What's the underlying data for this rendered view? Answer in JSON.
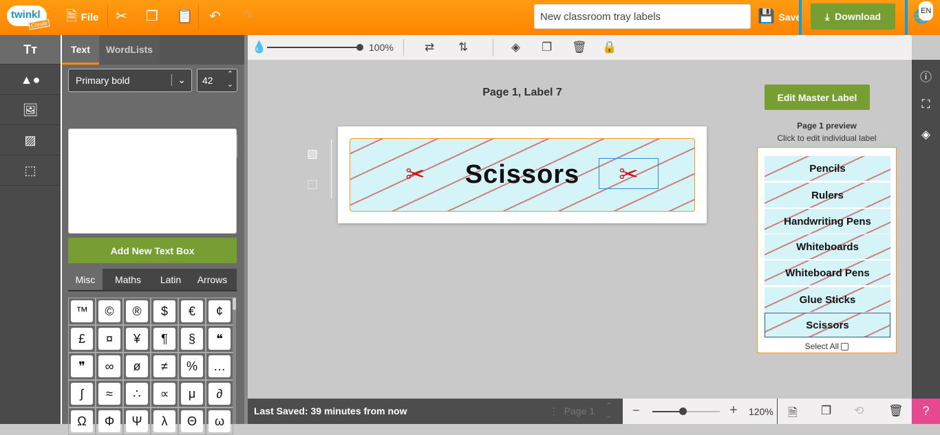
{
  "header": {
    "logo_text": "twinkl",
    "logo_sub": "Create",
    "file_label": "File",
    "document_title": "New classroom tray labels",
    "save_label": "Save",
    "download_label": "Download",
    "language": "EN"
  },
  "colors": {
    "brand_orange": "#ff8c00",
    "accent_green": "#779e32",
    "highlight_blue": "#0aa0e6",
    "help_pink": "#e8488f"
  },
  "panel": {
    "tabs": [
      "Text",
      "WordLists"
    ],
    "font": "Primary bold",
    "font_size": "42",
    "add_text_label": "Add New Text Box",
    "symbol_tabs": [
      "Misc",
      "Maths",
      "Latin",
      "Arrows"
    ],
    "symbols": [
      "™",
      "©",
      "®",
      "$",
      "€",
      "¢",
      "£",
      "¤",
      "¥",
      "¶",
      "§",
      "❝",
      "❞",
      "∞",
      "ø",
      "≠",
      "%",
      "…",
      "∫",
      "≈",
      "∴",
      "∝",
      "μ",
      "∂",
      "Ω",
      "Φ",
      "Ψ",
      "λ",
      "Θ",
      "ω"
    ]
  },
  "canvas_toolbar": {
    "opacity": "100%"
  },
  "canvas": {
    "heading": "Page 1, Label 7",
    "label_text": "Scissors",
    "edit_master_label": "Edit Master Label"
  },
  "preview": {
    "title": "Page 1 preview",
    "subtitle": "Click to edit individual label",
    "labels": [
      "Pencils",
      "Rulers",
      "Handwriting Pens",
      "Whiteboards",
      "Whiteboard Pens",
      "Glue Sticks",
      "Scissors"
    ],
    "select_all": "Select All"
  },
  "footer": {
    "last_saved": "Last Saved: 39 minutes from now",
    "page": "Page 1",
    "zoom": "120%",
    "zoom_fraction": 0.45
  }
}
